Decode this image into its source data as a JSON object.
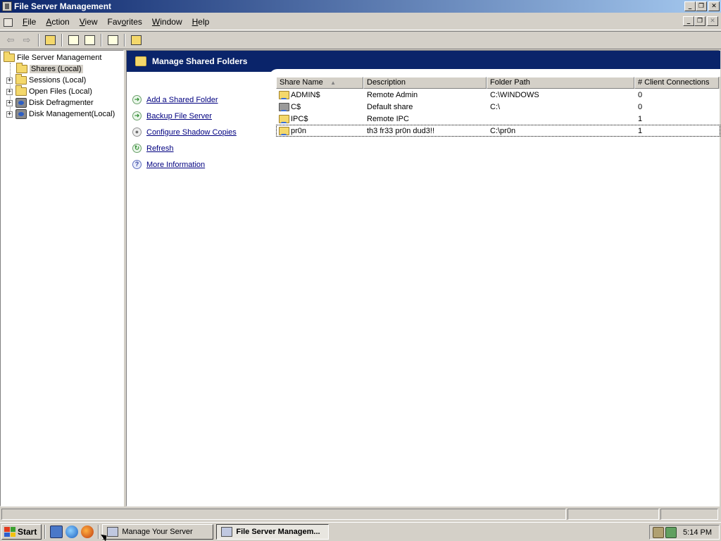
{
  "window": {
    "title": "File Server Management"
  },
  "menu": {
    "items": [
      {
        "pre": "",
        "ul": "F",
        "post": "ile"
      },
      {
        "pre": "",
        "ul": "A",
        "post": "ction"
      },
      {
        "pre": "",
        "ul": "V",
        "post": "iew"
      },
      {
        "pre": "Fav",
        "ul": "o",
        "post": "rites"
      },
      {
        "pre": "",
        "ul": "W",
        "post": "indow"
      },
      {
        "pre": "",
        "ul": "H",
        "post": "elp"
      }
    ]
  },
  "toolbar": {
    "icons": [
      "back-arrow-icon",
      "forward-arrow-icon",
      "up-one-level-icon",
      "refresh-icon",
      "export-list-icon",
      "help-icon",
      "shadow-copy-icon"
    ]
  },
  "tree": {
    "root": "File Server Management",
    "items": [
      {
        "label": "Shares (Local)",
        "expandable": false,
        "selected": true
      },
      {
        "label": "Sessions (Local)",
        "expandable": true,
        "selected": false
      },
      {
        "label": "Open Files (Local)",
        "expandable": true,
        "selected": false
      },
      {
        "label": "Disk Defragmenter",
        "expandable": true,
        "selected": false
      },
      {
        "label": "Disk Management(Local)",
        "expandable": true,
        "selected": false
      }
    ]
  },
  "header": {
    "title": "Manage Shared Folders"
  },
  "tasks": [
    {
      "label": "Add a Shared Folder",
      "icon": "arrow-go-icon"
    },
    {
      "label": "Backup File Server",
      "icon": "arrow-go-icon"
    },
    {
      "label": "Configure Shadow Copies",
      "icon": "shadow-copy-icon"
    },
    {
      "label": "Refresh",
      "icon": "refresh-icon"
    },
    {
      "label": "More Information",
      "icon": "help-icon"
    }
  ],
  "list": {
    "columns": [
      "Share Name",
      "Description",
      "Folder Path",
      "# Client Connections"
    ],
    "rows": [
      {
        "name": "ADMIN$",
        "description": "Remote Admin",
        "path": "C:\\WINDOWS",
        "connections": "0"
      },
      {
        "name": "C$",
        "description": "Default share",
        "path": "C:\\",
        "connections": "0"
      },
      {
        "name": "IPC$",
        "description": "Remote IPC",
        "path": "",
        "connections": "1"
      },
      {
        "name": "pr0n",
        "description": "th3 fr33 pr0n dud3!!",
        "path": "C:\\pr0n",
        "connections": "1"
      }
    ]
  },
  "taskbar": {
    "start_label": "Start",
    "buttons": [
      {
        "label": "Manage Your Server",
        "active": false
      },
      {
        "label": "File Server Managem...",
        "active": true
      }
    ],
    "clock": "5:14 PM"
  },
  "colors": {
    "title_gradient_start": "#0a246a",
    "title_gradient_end": "#a6caf0",
    "header_band": "#0a246a",
    "link": "#000080",
    "face": "#d4d0c8"
  }
}
